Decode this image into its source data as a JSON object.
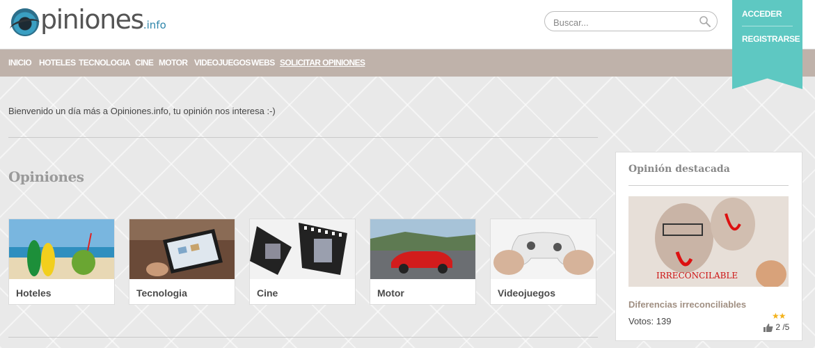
{
  "header": {
    "logo": {
      "main": "piniones",
      "tld": ".info"
    },
    "search": {
      "placeholder": "Buscar..."
    },
    "auth": {
      "login": "ACCEDER",
      "register": "REGISTRARSE"
    }
  },
  "nav": {
    "items": [
      "INICIO",
      "HOTELES",
      "TECNOLOGIA",
      "CINE",
      "MOTOR",
      "VIDEOJUEGOS",
      "WEBS",
      "SOLICITAR OPINIONES"
    ]
  },
  "welcome": "Bienvenido un día más a Opiniones.info, tu opinión nos interesa :-)",
  "opiniones": {
    "title": "Opiniones",
    "categories": [
      "Hoteles",
      "Tecnologia",
      "Cine",
      "Motor",
      "Videojuegos"
    ]
  },
  "featured": {
    "title": "Opinión destacada",
    "item_title": "Diferencias irreconciliables",
    "votes": "Votos: 139",
    "stars": "★★",
    "rating": "2 /5"
  },
  "colors": {
    "nav_bg": "#bfb2aa",
    "accent_ribbon": "#5ec8c2",
    "logo_tld": "#2e86ab",
    "star": "#f3b21c"
  }
}
